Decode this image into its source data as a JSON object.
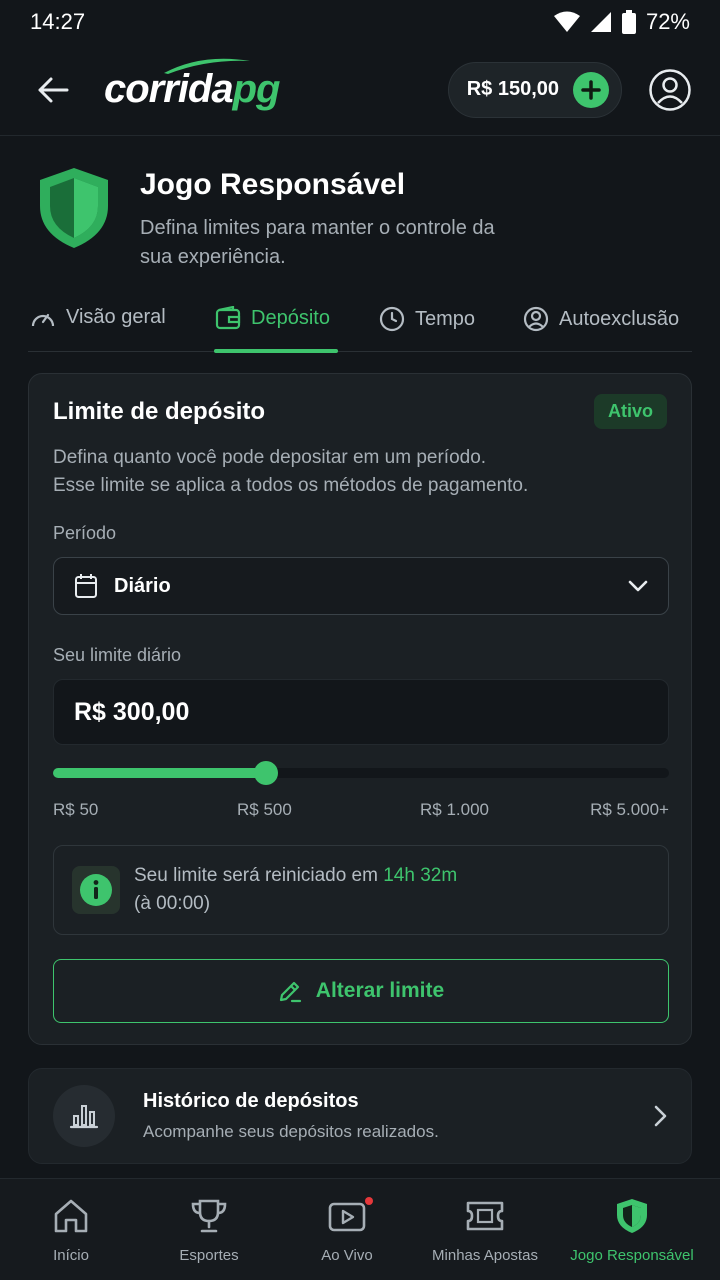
{
  "status": {
    "time": "14:27",
    "battery": "72%"
  },
  "header": {
    "logo_part1": "corrida",
    "logo_part2": "pg",
    "balance": "R$ 150,00"
  },
  "hero": {
    "title": "Jogo Responsável",
    "subtitle": "Defina limites para manter o controle da sua experiência."
  },
  "tabs": [
    {
      "label": "Visão geral",
      "icon": "gauge-icon"
    },
    {
      "label": "Depósito",
      "icon": "wallet-icon",
      "active": true
    },
    {
      "label": "Tempo",
      "icon": "clock-icon"
    },
    {
      "label": "Autoexclusão",
      "icon": "user-circle-icon"
    }
  ],
  "deposit": {
    "title": "Limite de depósito",
    "badge": "Ativo",
    "desc_line1": "Defina quanto você pode depositar em um período.",
    "desc_line2": "Esse limite se aplica a todos os métodos de pagamento.",
    "period_label": "Período",
    "period_value": "Diário",
    "limit_label": "Seu limite diário",
    "limit_value": "R$ 300,00",
    "slider_fraction": 0.345,
    "ticks": [
      "R$ 50",
      "R$ 500",
      "R$ 1.000",
      "R$ 5.000+"
    ],
    "info_text": "Seu limite será reiniciado em ",
    "info_highlight": "14h 32m",
    "info_sub": "(à 00:00)",
    "button": "Alterar limite"
  },
  "history": {
    "title": "Histórico de depósitos",
    "subtitle": "Acompanhe seus depósitos realizados."
  },
  "nav": [
    {
      "label": "Início",
      "icon": "home-icon"
    },
    {
      "label": "Esportes",
      "icon": "trophy-icon"
    },
    {
      "label": "Ao Vivo",
      "icon": "live-video-icon"
    },
    {
      "label": "Minhas Apostas",
      "icon": "ticket-icon"
    },
    {
      "label": "Jogo Responsável",
      "icon": "shield-icon",
      "active": true
    }
  ],
  "colors": {
    "accent": "#3ec46d",
    "background": "#12161a",
    "card": "#1b2024",
    "live_dot": "#e5383b"
  }
}
